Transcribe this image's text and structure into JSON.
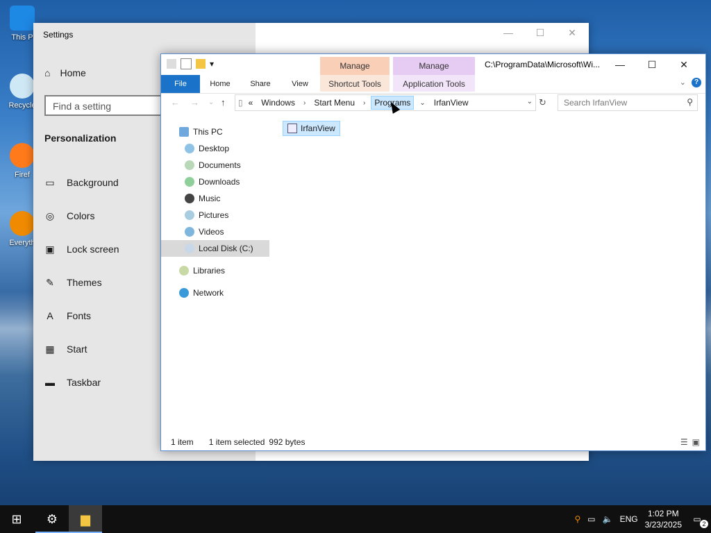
{
  "desktop": {
    "icons": [
      {
        "label": "This P",
        "icon": "this-pc-icon"
      },
      {
        "label": "Recycle",
        "icon": "recycle-bin-icon"
      },
      {
        "label": "Firef",
        "icon": "firefox-icon"
      },
      {
        "label": "Everyth",
        "icon": "everything-icon"
      }
    ]
  },
  "settings": {
    "title": "Settings",
    "home": "Home",
    "find_placeholder": "Find a setting",
    "section": "Personalization",
    "nav": [
      {
        "label": "Background",
        "icon": "image-icon"
      },
      {
        "label": "Colors",
        "icon": "palette-icon"
      },
      {
        "label": "Lock screen",
        "icon": "lock-screen-icon"
      },
      {
        "label": "Themes",
        "icon": "themes-icon"
      },
      {
        "label": "Fonts",
        "icon": "fonts-icon"
      },
      {
        "label": "Start",
        "icon": "start-icon"
      },
      {
        "label": "Taskbar",
        "icon": "taskbar-icon"
      }
    ]
  },
  "explorer": {
    "title_path": "C:\\ProgramData\\Microsoft\\Wi...",
    "context_tabs": [
      {
        "label": "Manage",
        "sub": "Shortcut Tools",
        "color": "#f9cfb7"
      },
      {
        "label": "Manage",
        "sub": "Application Tools",
        "color": "#e6cbf2"
      }
    ],
    "ribbon_tabs": [
      "File",
      "Home",
      "Share",
      "View"
    ],
    "breadcrumb": {
      "prefix": "«",
      "crumbs": [
        "Windows",
        "Start Menu",
        "Programs",
        "IrfanView"
      ],
      "highlighted": "Programs"
    },
    "search_placeholder": "Search IrfanView",
    "tree": {
      "this_pc": "This PC",
      "children": [
        "Desktop",
        "Documents",
        "Downloads",
        "Music",
        "Pictures",
        "Videos",
        "Local Disk (C:)"
      ],
      "selected": "Local Disk (C:)",
      "libraries": "Libraries",
      "network": "Network"
    },
    "files": [
      {
        "name": "IrfanView",
        "icon": "shortcut-icon"
      }
    ],
    "status": {
      "count": "1 item",
      "selected": "1 item selected",
      "size": "992 bytes"
    }
  },
  "taskbar": {
    "lang": "ENG",
    "time": "1:02 PM",
    "date": "3/23/2025",
    "notifications": "2"
  }
}
